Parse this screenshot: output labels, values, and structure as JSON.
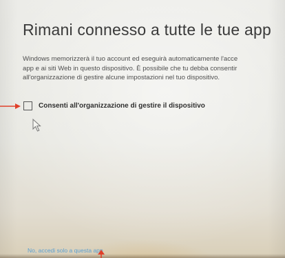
{
  "dialog": {
    "title": "Rimani connesso a tutte le tue app",
    "description_lines": [
      "Windows memorizzerà il tuo account ed eseguirà automaticamente l'acce",
      "app e ai siti Web in questo dispositivo. È possibile che tu debba consentir",
      "all'organizzazione di gestire alcune impostazioni nel tuo dispositivo."
    ],
    "checkbox": {
      "label": "Consenti all'organizzazione di gestire il dispositivo",
      "checked": false
    },
    "bottom_link": "No, accedi solo a questa app"
  },
  "annotations": {
    "arrow_color": "#e0402a",
    "arrow_left_icon": "red-arrow-right-icon",
    "arrow_bottom_icon": "red-arrow-up-icon"
  },
  "icons": {
    "cursor": "mouse-pointer-icon"
  },
  "colors": {
    "link": "#5b9fd0",
    "title_text": "#3a3a3a"
  }
}
